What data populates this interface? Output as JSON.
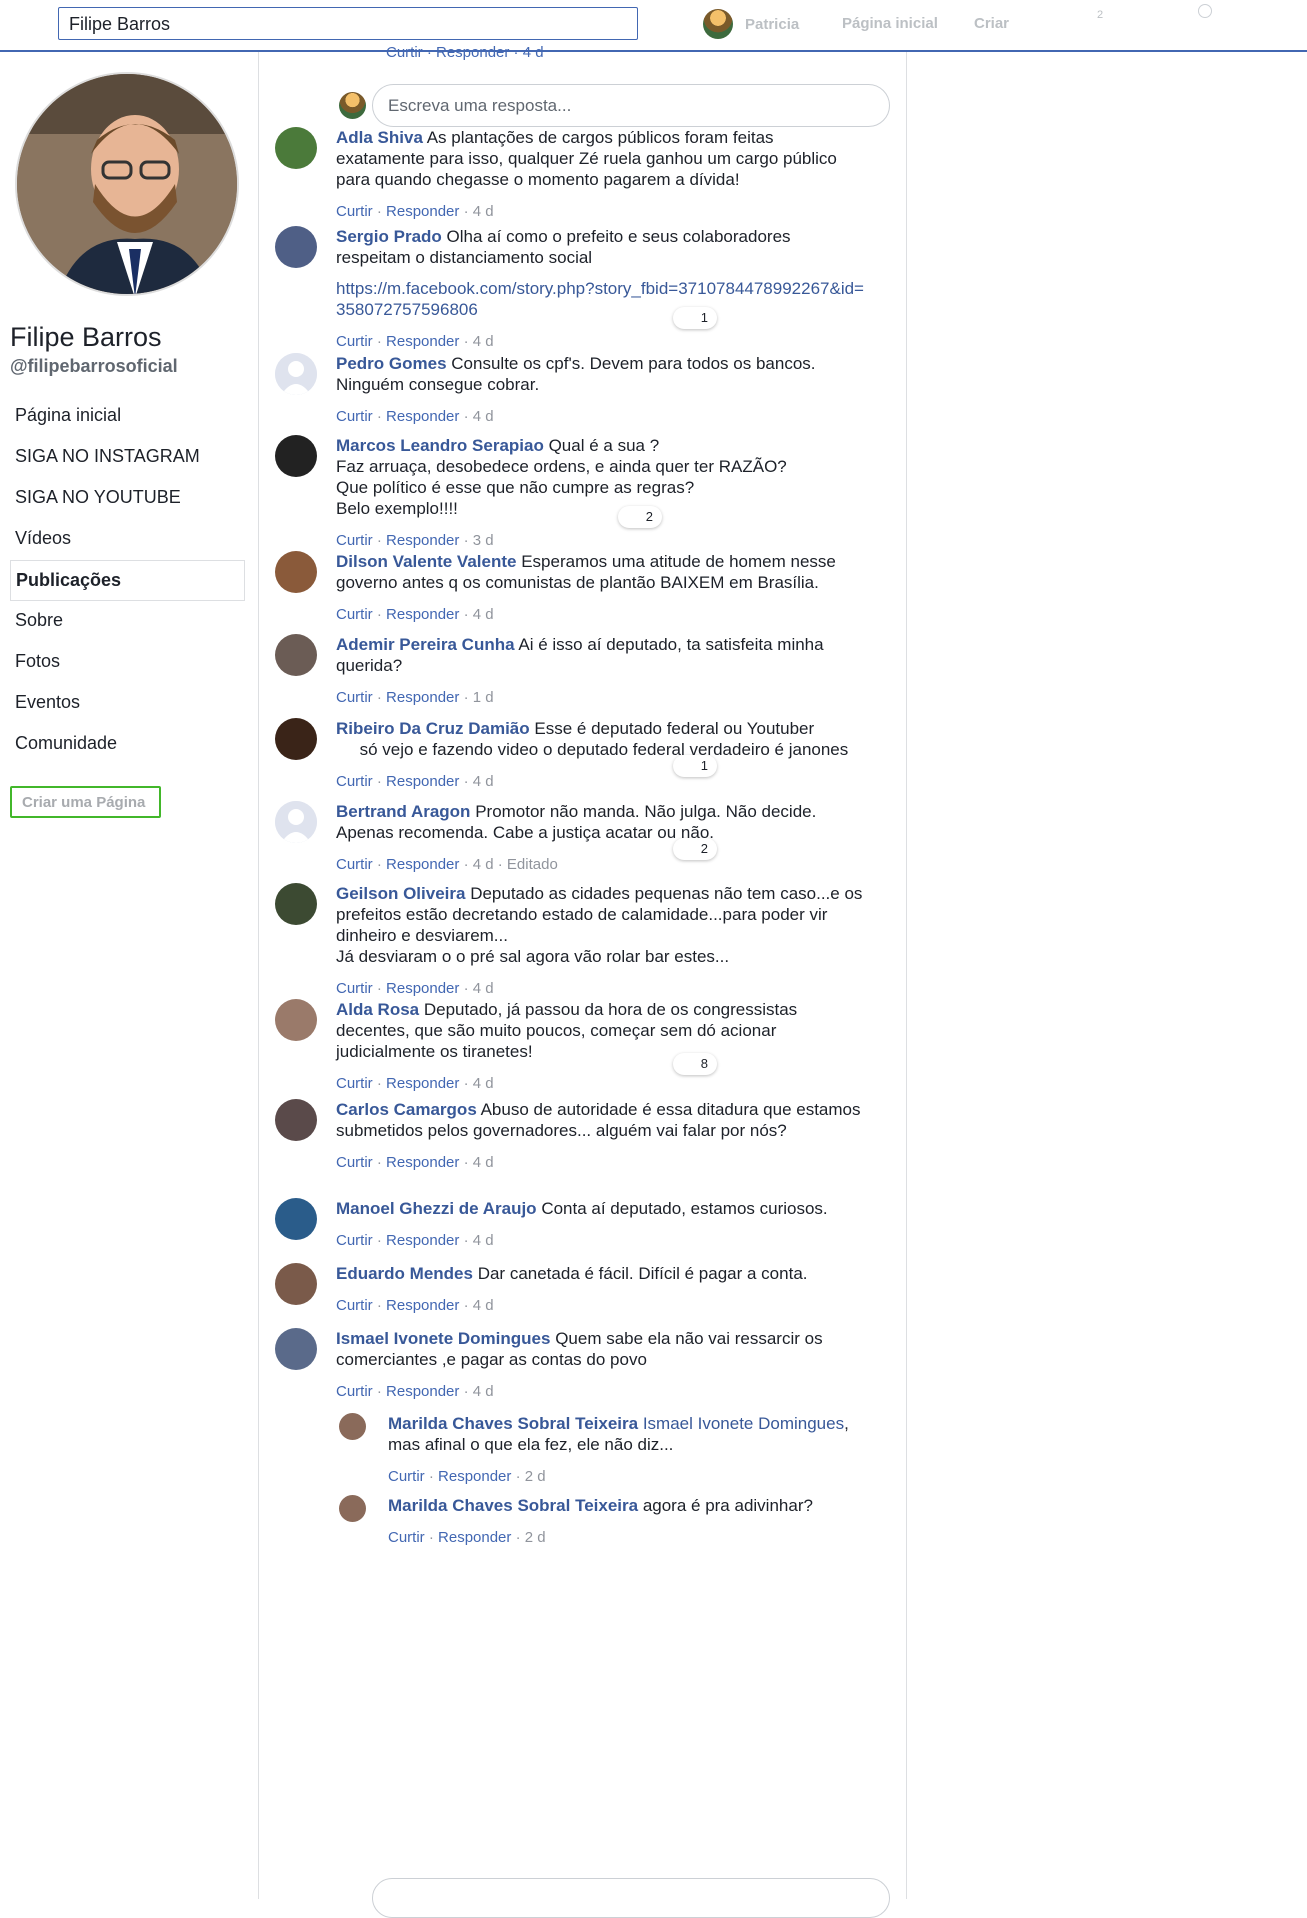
{
  "topbar": {
    "search_value": "Filipe Barros",
    "user_name": "Patricia",
    "home": "Página inicial",
    "create": "Criar",
    "badge": "2"
  },
  "profile": {
    "name": "Filipe Barros",
    "handle": "@filipebarrosoficial",
    "create_page": "Criar uma Página"
  },
  "menu": [
    {
      "label": "Página inicial"
    },
    {
      "label": "SIGA NO INSTAGRAM"
    },
    {
      "label": "SIGA NO YOUTUBE"
    },
    {
      "label": "Vídeos"
    },
    {
      "label": "Publicações"
    },
    {
      "label": "Sobre"
    },
    {
      "label": "Fotos"
    },
    {
      "label": "Eventos"
    },
    {
      "label": "Comunidade"
    }
  ],
  "feed": {
    "top_action": "Curtir · Responder · 4 d",
    "reply_placeholder": "Escreva uma resposta...",
    "like": "Curtir",
    "reply": "Responder",
    "comments": [
      {
        "name": "Adla Shiva",
        "text": "As plantações de cargos públicos foram feitas exatamente para isso, qualquer Zé ruela ganhou um cargo público para quando chegasse o momento pagarem a dívida!",
        "time": "· 4 d",
        "avatar_color": "#4b7a3a"
      },
      {
        "name": "Sergio Prado",
        "text": "Olha aí como o prefeito e seus colaboradores respeitam o distanciamento social",
        "link": "https://m.facebook.com/story.php?story_fbid=3710784478992267&id=358072757596806",
        "time": "· 4 d",
        "reaction": "1",
        "avatar_color": "#4f5f86"
      },
      {
        "name": "Pedro Gomes",
        "text": "Consulte os cpf's. Devem para todos os bancos. Ninguém consegue cobrar.",
        "time": "· 4 d",
        "avatar_color": "#dfe3ee"
      },
      {
        "name": "Marcos Leandro Serapiao",
        "text": "Qual é a sua ?\nFaz arruaça, desobedece ordens, e ainda quer ter RAZÃO?\nQue político é esse que não cumpre as regras?\nBelo exemplo!!!!",
        "time": "· 3 d",
        "reaction": "2",
        "avatar_color": "#222222"
      },
      {
        "name": "Dilson Valente Valente",
        "text": "Esperamos uma atitude de homem nesse governo antes q os comunistas de plantão BAIXEM em Brasília.",
        "time": "· 4 d",
        "avatar_color": "#8a5a3a"
      },
      {
        "name": "Ademir Pereira Cunha",
        "text": "Ai é isso aí deputado, ta satisfeita minha querida?",
        "time": "· 1 d",
        "avatar_color": "#6b5c55"
      },
      {
        "name": "Ribeiro Da Cruz Damião",
        "text": "Esse é deputado federal ou Youtuber\n     só vejo e fazendo video o deputado federal verdadeiro é janones",
        "time": "· 4 d",
        "reaction": "1",
        "avatar_color": "#3a2418"
      },
      {
        "name": "Bertrand Aragon",
        "text": "Promotor não manda. Não julga. Não decide. Apenas recomenda. Cabe a justiça acatar ou não.",
        "time": "· 4 d · Editado",
        "reaction": "2",
        "avatar_color": "#dfe3ee"
      },
      {
        "name": "Geilson Oliveira",
        "text": "Deputado as cidades pequenas não tem caso...e os prefeitos estão decretando estado de calamidade...para poder vir dinheiro e desviarem...\nJá desviaram o o pré sal agora vão rolar bar estes...",
        "time": "· 4 d",
        "avatar_color": "#3c4a32"
      },
      {
        "name": "Alda Rosa",
        "text": "Deputado, já passou da hora de os congressistas decentes, que são muito poucos, começar sem dó acionar judicialmente os tiranetes!",
        "time": "· 4 d",
        "reaction": "8",
        "avatar_color": "#9a7a6a"
      },
      {
        "name": "Carlos Camargos",
        "text": "Abuso de autoridade é essa ditadura que estamos submetidos pelos governadores... alguém vai falar por nós?",
        "time": "· 4 d",
        "avatar_color": "#5a4a4a"
      },
      {
        "name": "Manoel Ghezzi de Araujo",
        "text": "Conta aí deputado, estamos curiosos.",
        "time": "· 4 d",
        "avatar_color": "#2a5c8a"
      },
      {
        "name": "Eduardo Mendes",
        "text": "Dar canetada é fácil. Difícil é pagar a conta.",
        "time": "· 4 d",
        "avatar_color": "#7a5a4a"
      },
      {
        "name": "Ismael Ivonete Domingues",
        "text": "Quem sabe ela não vai ressarcir os comerciantes ,e pagar as contas do povo",
        "time": "· 4 d",
        "avatar_color": "#5a6a8a"
      }
    ],
    "replies": [
      {
        "name": "Marilda Chaves Sobral Teixeira",
        "mention": "Ismael Ivonete Domingues",
        "text": ", mas afinal o que ela fez, ele não diz...",
        "time": "· 2 d"
      },
      {
        "name": "Marilda Chaves Sobral Teixeira",
        "mention": "",
        "text": "agora é pra adivinhar?",
        "time": "· 2 d"
      }
    ]
  }
}
